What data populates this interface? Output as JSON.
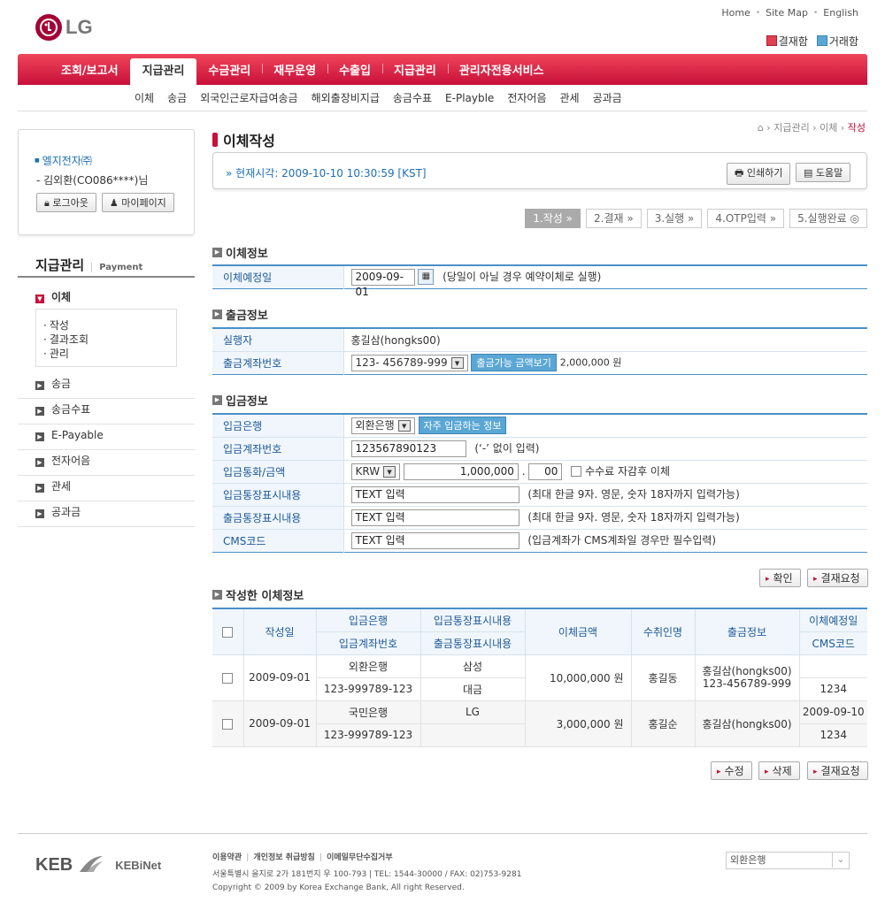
{
  "header": {
    "logo_text": "LG",
    "util_links": [
      "Home",
      "Site Map",
      "English"
    ],
    "quick": [
      "결재함",
      "거래함"
    ]
  },
  "gnb": [
    "조회/보고서",
    "지급관리",
    "수금관리",
    "재무운영",
    "수출입",
    "지급관리",
    "관리자전용서비스"
  ],
  "lnb": [
    "이체",
    "송금",
    "외국인근로자급여송금",
    "해외출장비지급",
    "송금수표",
    "E-Playble",
    "전자어음",
    "관세",
    "공과금"
  ],
  "user": {
    "company": "엘지전자㈜",
    "name": "- 김외환(CO086****)님",
    "logout": "로그아웃",
    "mypage": "마이페이지"
  },
  "left": {
    "title": "지급관리",
    "subtitle": "Payment",
    "active": "이체",
    "sub": [
      "작성",
      "결과조회",
      "관리"
    ],
    "menu": [
      "송금",
      "송금수표",
      "E-Payable",
      "전자어음",
      "관세",
      "공과금"
    ]
  },
  "page": {
    "title": "이체작성",
    "breadcrumb": [
      "지급관리",
      "이체",
      "작성"
    ],
    "time_label": "현재시각: 2009-10-10 10:30:59 [KST]",
    "print": "인쇄하기",
    "help": "도움말",
    "steps": [
      "1.작성",
      "2.결재",
      "3.실행",
      "4.OTP입력",
      "5.실행완료"
    ]
  },
  "transfer_info": {
    "section": "이체정보",
    "date_label": "이체예정일",
    "date_value": "2009-09-01",
    "date_note": "(당일이 아닐 경우 예약이체로 실행)"
  },
  "withdraw_info": {
    "section": "출금정보",
    "executor_label": "실행자",
    "executor_value": "홍길삼(hongks00)",
    "account_label": "출금계좌번호",
    "account_value": "123- 456789-999",
    "balance_btn": "출금가능 금액보기",
    "balance_value": "2,000,000 원"
  },
  "deposit_info": {
    "section": "입금정보",
    "bank_label": "입금은행",
    "bank_value": "외환은행",
    "frequent_btn": "자주 입금하는 정보",
    "account_label": "입금계좌번호",
    "account_value": "123567890123",
    "account_note": "(‘-’ 없이 입력)",
    "currency_label": "입금통화/금액",
    "currency_value": "KRW",
    "amount_value": "1,000,000",
    "amount_decimal": "00",
    "fee_label": "수수료 자감후 이체",
    "in_memo_label": "입금통장표시내용",
    "in_memo_value": "TEXT 입력",
    "in_memo_note": "(최대 한글 9자. 영문, 숫자 18자까지 입력가능)",
    "out_memo_label": "출금통장표시내용",
    "out_memo_value": "TEXT 입력",
    "out_memo_note": "(최대 한글 9자. 영문, 숫자 18자까지 입력가능)",
    "cms_label": "CMS코드",
    "cms_value": "TEXT 입력",
    "cms_note": "(입금계좌가 CMS계좌일 경우만 필수입력)"
  },
  "buttons": {
    "confirm": "확인",
    "approve_request": "결재요청",
    "edit": "수정",
    "delete": "삭제",
    "approve_request2": "결재요청"
  },
  "list": {
    "section": "작성한 이체정보",
    "headers": {
      "date": "작성일",
      "bank": "입금은행",
      "account": "입금계좌번호",
      "in_memo": "입금통장표시내용",
      "in_memo2": "출금통장표시내용",
      "amount": "이체금액",
      "receiver": "수취인명",
      "withdraw": "출금정보",
      "sched": "이체예정일",
      "cms": "CMS코드"
    },
    "rows": [
      {
        "date": "2009-09-01",
        "bank": "외환은행",
        "account": "123-999789-123",
        "memo1": "삼성",
        "memo2": "대금",
        "amount": "10,000,000 원",
        "receiver": "홍길동",
        "withdraw1": "홍길삼(hongks00)",
        "withdraw2": "123-456789-999",
        "sched": "",
        "cms": "1234"
      },
      {
        "date": "2009-09-01",
        "bank": "국민은행",
        "account": "123-999789-123",
        "memo1": "LG",
        "memo2": "",
        "amount": "3,000,000 원",
        "receiver": "홍길순",
        "withdraw1": "홍길삼(hongks00)",
        "withdraw2": "",
        "sched": "2009-09-10",
        "cms": "1234"
      }
    ]
  },
  "footer": {
    "brand": "KEB",
    "brand2": "KEBiNet",
    "links": [
      "이용약관",
      "개인정보 취급방침",
      "이메일무단수집거부"
    ],
    "address": "서울특별시 을지로 2가 181번지 우 100-793  |  TEL: 1544-30000  /  FAX: 02)753-9281",
    "copyright": "Copyright © 2009 by Korea Exchange Bank, All right Reserved.",
    "family_select": "외환은행"
  },
  "colors": {
    "brand": "#c8103a",
    "accent": "#4a90c8"
  }
}
